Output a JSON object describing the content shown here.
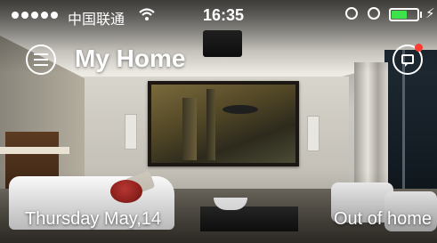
{
  "status_bar": {
    "carrier": "中国联通",
    "wifi_icon": "wifi-icon",
    "time": "16:35",
    "battery_level": 0.6,
    "battery_color": "#3ee24a",
    "charging_glyph": "⚡"
  },
  "header": {
    "title": "My Home",
    "menu_icon": "hamburger-icon",
    "messages_icon": "message-icon",
    "notification_badge_color": "#ff3b30"
  },
  "footer": {
    "date": "Thursday May,14",
    "home_mode": "Out of home"
  }
}
